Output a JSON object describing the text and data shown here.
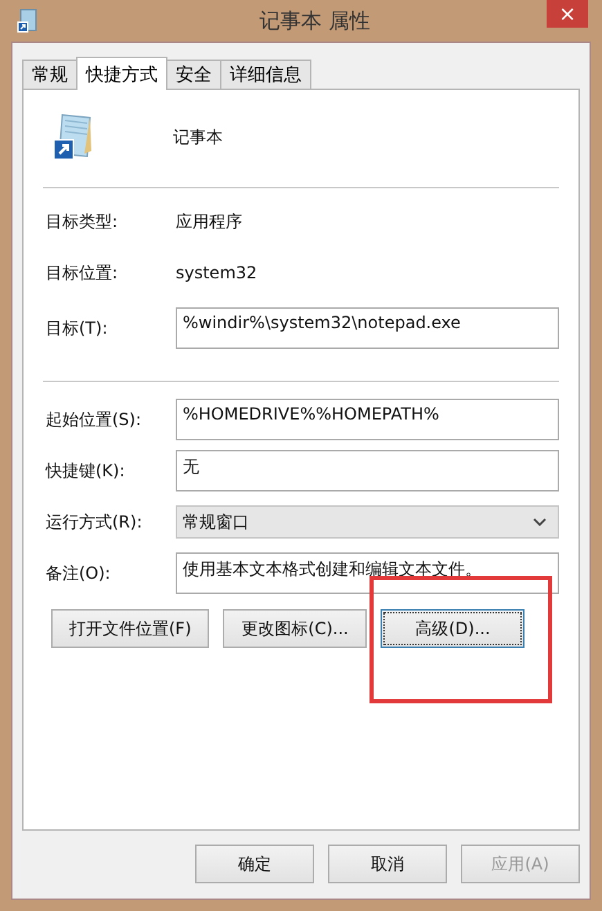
{
  "window": {
    "title": "记事本 属性",
    "close": "×"
  },
  "tabs": [
    {
      "label": "常规",
      "selected": false
    },
    {
      "label": "快捷方式",
      "selected": true
    },
    {
      "label": "安全",
      "selected": false
    },
    {
      "label": "详细信息",
      "selected": false
    }
  ],
  "shortcut": {
    "name": "记事本"
  },
  "info": [
    {
      "label": "目标类型:",
      "value": "应用程序"
    },
    {
      "label": "目标位置:",
      "value": "system32"
    }
  ],
  "target": {
    "label": "目标(T):",
    "value": "%windir%\\system32\\notepad.exe"
  },
  "fields": [
    {
      "kind": "text",
      "label": "起始位置(S):",
      "value": "%HOMEDRIVE%%HOMEPATH%"
    },
    {
      "kind": "text",
      "label": "快捷键(K):",
      "value": "无"
    },
    {
      "kind": "select",
      "label": "运行方式(R):",
      "value": "常规窗口"
    },
    {
      "kind": "text",
      "label": "备注(O):",
      "value": "使用基本文本格式创建和编辑文本文件。"
    }
  ],
  "actions": [
    {
      "label": "打开文件位置(F)",
      "focused": false,
      "highlighted": false
    },
    {
      "label": "更改图标(C)...",
      "focused": false,
      "highlighted": false
    },
    {
      "label": "高级(D)...",
      "focused": true,
      "highlighted": true
    }
  ],
  "buttons": [
    {
      "label": "确定",
      "disabled": false
    },
    {
      "label": "取消",
      "disabled": false
    },
    {
      "label": "应用(A)",
      "disabled": true
    }
  ]
}
